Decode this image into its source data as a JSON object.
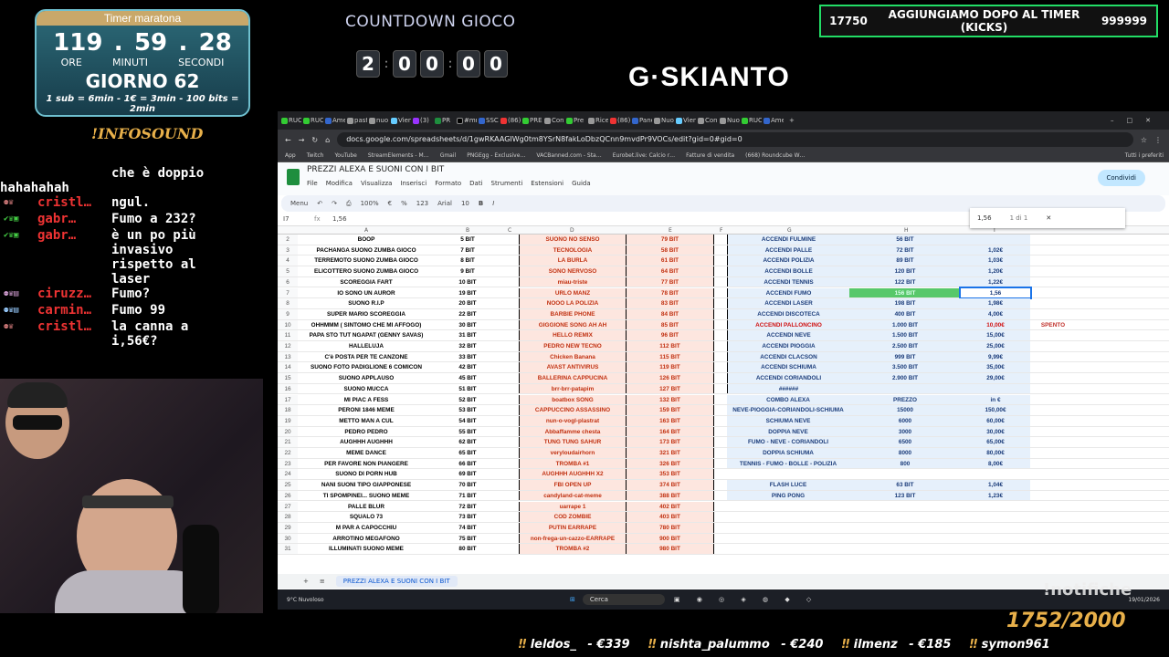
{
  "timer": {
    "title": "Timer maratona",
    "hours": "119",
    "minutes": "59",
    "seconds": "28",
    "unit_hours": "ORE",
    "unit_minutes": "MINUTI",
    "unit_seconds": "SECONDI",
    "day": "GIORNO 62",
    "rates": "1 sub = 6min - 1€ = 3min - 100 bits = 2min"
  },
  "infosound": "!INFOSOUND",
  "chat": [
    {
      "user": "",
      "text": "che è doppio hahahahah"
    },
    {
      "user": "cristl…",
      "text": "ngul."
    },
    {
      "user": "gabr…",
      "text": "Fumo a 232?"
    },
    {
      "user": "gabr…",
      "text": "è un po più invasivo rispetto al laser"
    },
    {
      "user": "ciruzz…",
      "text": "Fumo?"
    },
    {
      "user": "carmin…",
      "text": "Fumo 99"
    },
    {
      "user": "cristl…",
      "text": "la canna a i,56€?"
    }
  ],
  "countdown": {
    "title": "COUNTDOWN GIOCO",
    "digits": [
      "2",
      "0",
      "0",
      "0",
      "0"
    ]
  },
  "goal": {
    "current": "17750",
    "label": "AGGIUNGIAMO DOPO AL TIMER (KICKS)",
    "target": "999999"
  },
  "logo": "G·SKIANTO",
  "browser": {
    "url": "docs.google.com/spreadsheets/d/1gwRKAAGIWg0tm8YSrN8fakLoDbzQCnn9mvdPr9VOCs/edit?gid=0#gid=0",
    "bookmarks": [
      "App",
      "Twitch",
      "YouTube",
      "StreamElements - M…",
      "Gmail",
      "PNGEgg - Exclusive…",
      "VACBanned.com - Sta…",
      "Eurobet.live: Calcio r…",
      "Fatture di vendita",
      "(668) Roundcube W…",
      "Tutti i preferiti"
    ],
    "doc_title": "PREZZI ALEXA E SUONI CON I BIT",
    "menus": [
      "File",
      "Modifica",
      "Visualizza",
      "Inserisci",
      "Formato",
      "Dati",
      "Strumenti",
      "Estensioni",
      "Guida"
    ],
    "share": "Condividi",
    "toolbar": [
      "Menu",
      "100%",
      "€",
      "%",
      "123",
      "Arial",
      "10",
      "B",
      "I"
    ],
    "cell_ref": "I7",
    "formula": "1,56",
    "find_text": "1,56",
    "find_count": "1 di 1",
    "col_headers": [
      "A",
      "B",
      "C",
      "D",
      "E",
      "F",
      "G",
      "H",
      "I"
    ],
    "rows": [
      {
        "n": "2",
        "a": "BOOP",
        "b": "5 BIT",
        "d": "SUONO NO SENSO",
        "e": "79 BIT",
        "g": "ACCENDI FULMINE",
        "h": "56 BIT",
        "i": "",
        "j": ""
      },
      {
        "n": "3",
        "a": "PACHANGA SUONO ZUMBA GIOCO",
        "b": "7 BIT",
        "d": "TECNOLOGIA",
        "e": "58 BIT",
        "g": "ACCENDI PALLE",
        "h": "72 BIT",
        "i": "1,02€",
        "j": ""
      },
      {
        "n": "4",
        "a": "TERREMOTO SUONO ZUMBA GIOCO",
        "b": "8 BIT",
        "d": "LA BURLA",
        "e": "61 BIT",
        "g": "ACCENDI POLIZIA",
        "h": "89 BIT",
        "i": "1,03€",
        "j": ""
      },
      {
        "n": "5",
        "a": "ELICOTTERO SUONO ZUMBA GIOCO",
        "b": "9 BIT",
        "d": "SONO NERVOSO",
        "e": "64 BIT",
        "g": "ACCENDI BOLLE",
        "h": "120 BIT",
        "i": "1,20€",
        "j": ""
      },
      {
        "n": "6",
        "a": "SCOREGGIA FART",
        "b": "10 BIT",
        "d": "miau-triste",
        "e": "77 BIT",
        "g": "ACCENDI TENNIS",
        "h": "122 BIT",
        "i": "1,22€",
        "j": ""
      },
      {
        "n": "7",
        "a": "IO SONO UN AUROR",
        "b": "19 BIT",
        "d": "URLO MANZ",
        "e": "78 BIT",
        "g": "ACCENDI FUMO",
        "h": "156 BIT",
        "i": "1,56",
        "j": ""
      },
      {
        "n": "8",
        "a": "SUONO R.I.P",
        "b": "20 BIT",
        "d": "NOOO LA POLIZIA",
        "e": "83 BIT",
        "g": "ACCENDI LASER",
        "h": "198 BIT",
        "i": "1,98€",
        "j": ""
      },
      {
        "n": "9",
        "a": "SUPER MARIO SCOREGGIA",
        "b": "22 BIT",
        "d": "BARBIE PHONE",
        "e": "84 BIT",
        "g": "ACCENDI DISCOTECA",
        "h": "400 BIT",
        "i": "4,00€",
        "j": ""
      },
      {
        "n": "10",
        "a": "OHHMMM ( SINTOMO CHE MI AFFOGO)",
        "b": "30 BIT",
        "d": "GIGGIONE SONG AH AH",
        "e": "85 BIT",
        "g": "ACCENDI PALLONCINO",
        "h": "1.000 BIT",
        "i": "10,00€",
        "j": "SPENTO"
      },
      {
        "n": "11",
        "a": "PAPA STO TUT NGAPAT (GENNY SAVAS)",
        "b": "31 BIT",
        "d": "HELLO REMIX",
        "e": "96 BIT",
        "g": "ACCENDI NEVE",
        "h": "1.500 BIT",
        "i": "15,00€",
        "j": ""
      },
      {
        "n": "12",
        "a": "HALLELUJA",
        "b": "32 BIT",
        "d": "PEDRO NEW TECNO",
        "e": "112 BIT",
        "g": "ACCENDI PIOGGIA",
        "h": "2.500 BIT",
        "i": "25,00€",
        "j": ""
      },
      {
        "n": "13",
        "a": "C'è POSTA PER TE CANZONE",
        "b": "33 BIT",
        "d": "Chicken Banana",
        "e": "115 BIT",
        "g": "ACCENDI CLACSON",
        "h": "999 BIT",
        "i": "9,99€",
        "j": ""
      },
      {
        "n": "14",
        "a": "SUONO FOTO PADIGLIONE 6 COMICON",
        "b": "42 BIT",
        "d": "AVAST ANTIVIRUS",
        "e": "119 BIT",
        "g": "ACCENDI SCHIUMA",
        "h": "3.500 BIT",
        "i": "35,00€",
        "j": ""
      },
      {
        "n": "15",
        "a": "SUONO APPLAUSO",
        "b": "45 BIT",
        "d": "BALLERINA CAPPUCINA",
        "e": "126 BIT",
        "g": "ACCENDI CORIANDOLI",
        "h": "2.900 BIT",
        "i": "29,00€",
        "j": ""
      },
      {
        "n": "16",
        "a": "SUONO MUCCA",
        "b": "51 BIT",
        "d": "brr-brr-patapim",
        "e": "127 BIT",
        "g": "######",
        "h": "",
        "i": "",
        "j": ""
      },
      {
        "n": "17",
        "a": "MI PIAC A FESS",
        "b": "52 BIT",
        "d": "boatbox SONG",
        "e": "132 BIT",
        "g": "COMBO ALEXA",
        "h": "PREZZO",
        "i": "in €",
        "j": ""
      },
      {
        "n": "18",
        "a": "PERONI 1846 MEME",
        "b": "53 BIT",
        "d": "CAPPUCCINO ASSASSINO",
        "e": "159 BIT",
        "g": "NEVE-PIOGGIA-CORIANDOLI-SCHIUMA",
        "h": "15000",
        "i": "150,00€",
        "j": ""
      },
      {
        "n": "19",
        "a": "METTO MAN A CUL",
        "b": "54 BIT",
        "d": "nun-o-vogl-plastrat",
        "e": "163 BIT",
        "g": "SCHIUMA NEVE",
        "h": "6000",
        "i": "60,00€",
        "j": ""
      },
      {
        "n": "20",
        "a": "PEDRO PEDRO",
        "b": "55 BIT",
        "d": "Abbaffamme chesta",
        "e": "164 BIT",
        "g": "DOPPIA NEVE",
        "h": "3000",
        "i": "30,00€",
        "j": ""
      },
      {
        "n": "21",
        "a": "AUGHHH AUGHHH",
        "b": "62 BIT",
        "d": "TUNG TUNG SAHUR",
        "e": "173 BIT",
        "g": "FUMO - NEVE - CORIANDOLI",
        "h": "6500",
        "i": "65,00€",
        "j": ""
      },
      {
        "n": "22",
        "a": "MEME DANCE",
        "b": "65 BIT",
        "d": "veryloudairhorn",
        "e": "321 BIT",
        "g": "DOPPIA SCHIUMA",
        "h": "8000",
        "i": "80,00€",
        "j": ""
      },
      {
        "n": "23",
        "a": "PER FAVORE NON PIANGERE",
        "b": "66 BIT",
        "d": "TROMBA #1",
        "e": "326 BIT",
        "g": "TENNIS - FUMO - BOLLE - POLIZIA",
        "h": "800",
        "i": "8,00€",
        "j": ""
      },
      {
        "n": "24",
        "a": "SUONO DI PORN HUB",
        "b": "69 BIT",
        "d": "AUGHHH AUGHHH X2",
        "e": "353 BIT",
        "g": "",
        "h": "",
        "i": "",
        "j": ""
      },
      {
        "n": "25",
        "a": "NANI SUONI TIPO GIAPPONESE",
        "b": "70 BIT",
        "d": "FBI OPEN UP",
        "e": "374 BIT",
        "g": "FLASH LUCE",
        "h": "63 BIT",
        "i": "1,04€",
        "j": ""
      },
      {
        "n": "26",
        "a": "TI SPOMPINEI... SUONO MEME",
        "b": "71 BIT",
        "d": "candyland-cat-meme",
        "e": "388 BIT",
        "g": "PING PONG",
        "h": "123 BIT",
        "i": "1,23€",
        "j": ""
      },
      {
        "n": "27",
        "a": "PALLE BLUR",
        "b": "72 BIT",
        "d": "uarrape 1",
        "e": "402 BIT",
        "g": "",
        "h": "",
        "i": "",
        "j": ""
      },
      {
        "n": "28",
        "a": "SQUALO 73",
        "b": "73 BIT",
        "d": "COD ZOMBIE",
        "e": "403 BIT",
        "g": "",
        "h": "",
        "i": "",
        "j": ""
      },
      {
        "n": "29",
        "a": "M PAR A CAPOCCHIU",
        "b": "74 BIT",
        "d": "PUTIN EARRAPE",
        "e": "780 BIT",
        "g": "",
        "h": "",
        "i": "",
        "j": ""
      },
      {
        "n": "30",
        "a": "ARROTINO MEGAFONO",
        "b": "75 BIT",
        "d": "non-frega-un-cazzo-EARRAPE",
        "e": "900 BIT",
        "g": "",
        "h": "",
        "i": "",
        "j": ""
      },
      {
        "n": "31",
        "a": "ILLUMINATI SUONO MEME",
        "b": "80 BIT",
        "d": "TROMBA #2",
        "e": "980 BIT",
        "g": "",
        "h": "",
        "i": "",
        "j": ""
      }
    ],
    "sheet_tab": "PREZZI ALEXA E SUONI CON I BIT",
    "weather": "9°C Nuvoloso",
    "search": "Cerca",
    "time": "19/01/2026"
  },
  "notifiche": "!notifiche",
  "counter": "1752/2000",
  "ticker": [
    {
      "name": "leldos_",
      "amount": "€339"
    },
    {
      "name": "nishta_palummo",
      "amount": "€240"
    },
    {
      "name": "ilmenz",
      "amount": "€185"
    },
    {
      "name": "symon961",
      "amount": ""
    }
  ],
  "colors": {
    "accent_orange": "#e8b04a",
    "chat_name_red": "#e33",
    "goal_green": "#22dd66"
  }
}
